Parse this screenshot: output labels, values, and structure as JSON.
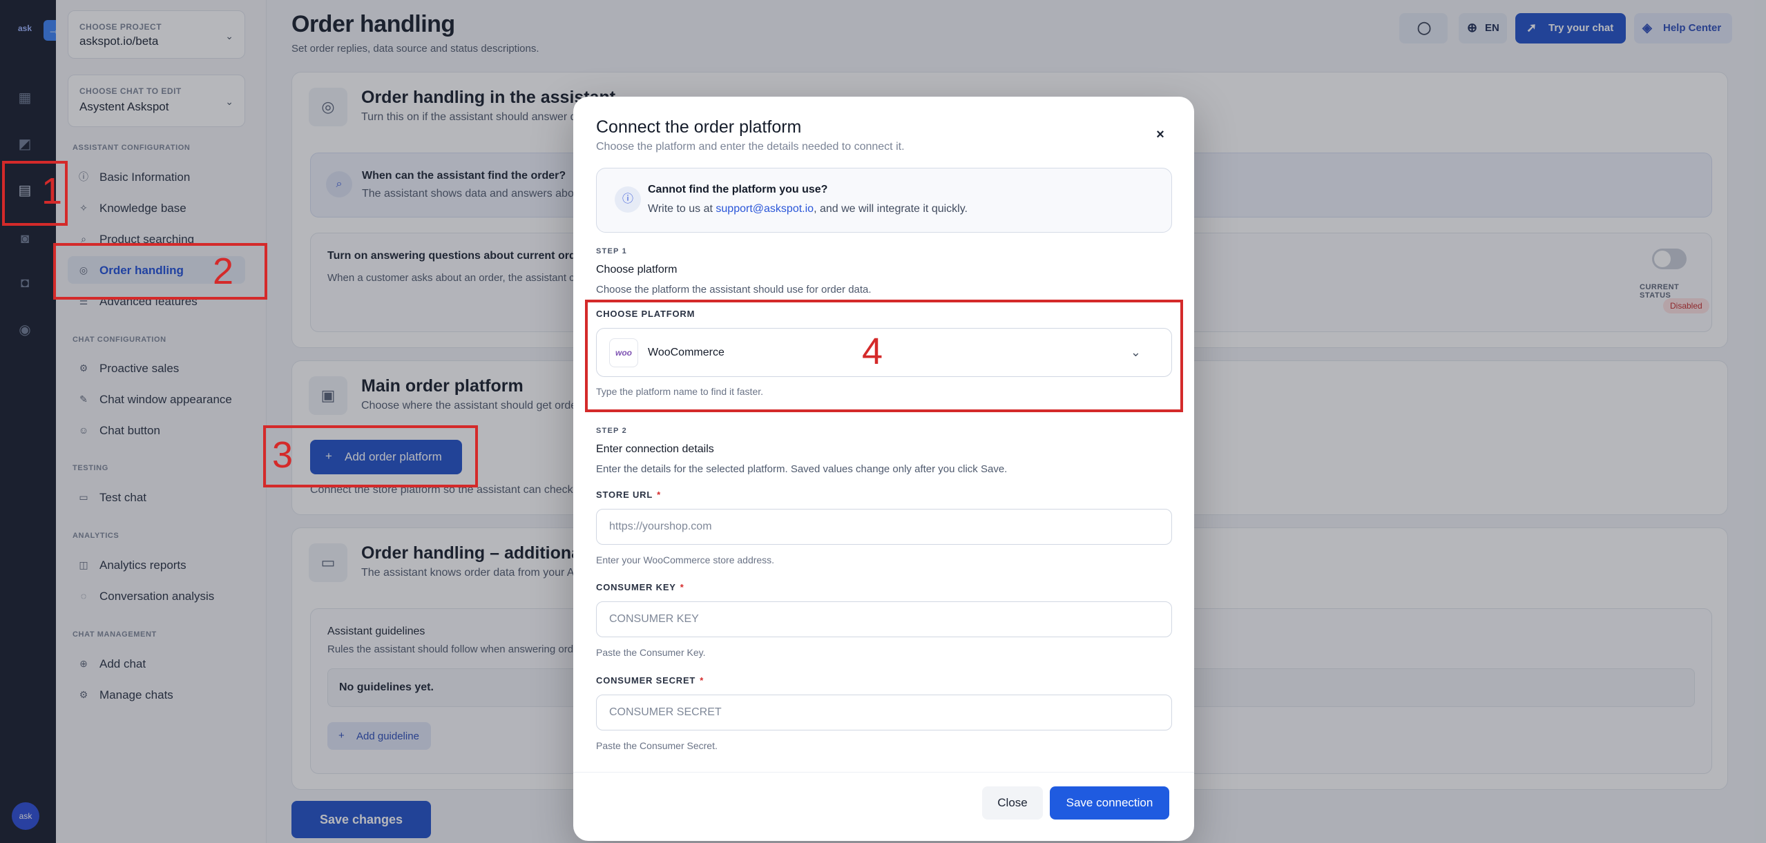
{
  "rail": {
    "logo": "ask",
    "bubble": "ask"
  },
  "sidebar": {
    "project": {
      "caption": "CHOOSE PROJECT",
      "value": "askspot.io/beta"
    },
    "chat": {
      "caption": "CHOOSE CHAT TO EDIT",
      "value": "Asystent Askspot"
    },
    "sections": {
      "assistant": "ASSISTANT CONFIGURATION",
      "chat": "CHAT CONFIGURATION",
      "testing": "TESTING",
      "analytics": "ANALYTICS",
      "management": "CHAT MANAGEMENT"
    },
    "items": {
      "basic": "Basic Information",
      "knowledge": "Knowledge base",
      "product": "Product searching",
      "order": "Order handling",
      "advanced": "Advanced features",
      "proactive": "Proactive sales",
      "appearance": "Chat window appearance",
      "button": "Chat button",
      "test": "Test chat",
      "reports": "Analytics reports",
      "conversation": "Conversation analysis",
      "add": "Add chat",
      "manage": "Manage chats"
    }
  },
  "header": {
    "title": "Order handling",
    "subtitle": "Set order replies, data source and status descriptions.",
    "lang": "EN",
    "try_chat": "Try your chat",
    "help": "Help Center"
  },
  "card1": {
    "title": "Order handling in the assistant",
    "subtitle": "Turn this on if the assistant should answer q",
    "find_title": "When can the assistant find the order?",
    "find_text": "The assistant shows data and answers abou",
    "toggle_title": "Turn on answering questions about current orders",
    "toggle_text": "When a customer asks about an order, the assistant ce",
    "status_caption": "CURRENT STATUS",
    "status_value": "Disabled"
  },
  "card2": {
    "title": "Main order platform",
    "subtitle": "Choose where the assistant should get orde",
    "add_button": "Add order platform",
    "note": "Connect the store platform so the assistant can check"
  },
  "card3": {
    "title": "Order handling – additional in",
    "subtitle": "The assistant knows order data from your A",
    "guidelines_title": "Assistant guidelines",
    "guidelines_text": "Rules the assistant should follow when answering order",
    "empty": "No guidelines yet.",
    "add_guideline": "Add guideline"
  },
  "footer": {
    "save_changes": "Save changes"
  },
  "modal": {
    "title": "Connect the order platform",
    "subtitle": "Choose the platform and enter the details needed to connect it.",
    "info_title": "Cannot find the platform you use?",
    "info_pre": "Write to us at ",
    "info_link": "support@askspot.io",
    "info_post": ", and we will integrate it quickly.",
    "step1": "STEP 1",
    "step1_title": "Choose platform",
    "step1_desc": "Choose the platform the assistant should use for order data.",
    "platform_label": "CHOOSE PLATFORM",
    "platform_logo": "woo",
    "platform_value": "WooCommerce",
    "platform_hint": "Type the platform name to find it faster.",
    "step2": "STEP 2",
    "step2_title": "Enter connection details",
    "step2_desc": "Enter the details for the selected platform. Saved values change only after you click Save.",
    "store_url_label": "STORE URL",
    "store_url_placeholder": "https://yourshop.com",
    "store_url_hint": "Enter your WooCommerce store address.",
    "consumer_key_label": "CONSUMER KEY",
    "consumer_key_placeholder": "CONSUMER KEY",
    "consumer_key_hint": "Paste the Consumer Key.",
    "consumer_secret_label": "CONSUMER SECRET",
    "consumer_secret_placeholder": "CONSUMER SECRET",
    "consumer_secret_hint": "Paste the Consumer Secret.",
    "required_mark": "*",
    "close": "Close",
    "save": "Save connection"
  },
  "annotations": {
    "n1": "1",
    "n2": "2",
    "n3": "3",
    "n4": "4"
  },
  "colors": {
    "primary": "#1f5be0",
    "annotation": "#d42a2a",
    "rail": "#141b2b"
  }
}
